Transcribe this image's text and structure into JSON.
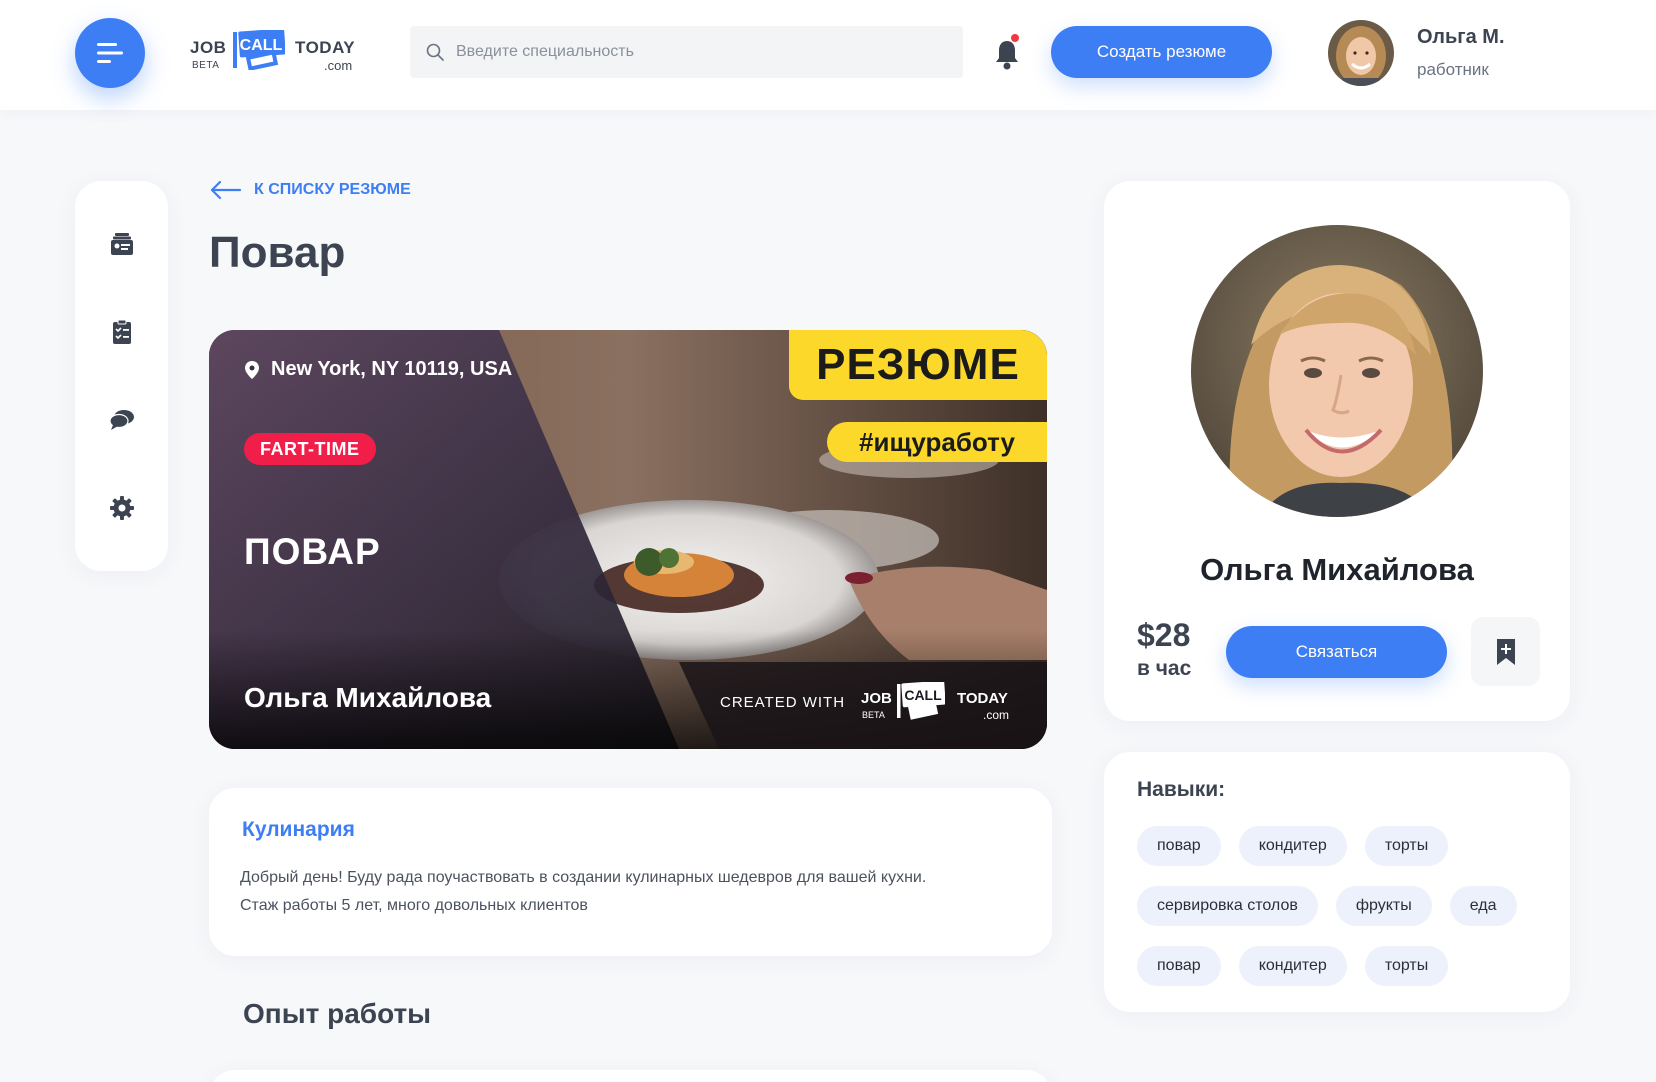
{
  "header": {
    "logo": {
      "job": "JOB",
      "beta": "BETA",
      "call": "CALL",
      "today": "TODAY",
      "com": ".com"
    },
    "search": {
      "placeholder": "Введите специальность",
      "value": ""
    },
    "create_resume_label": "Создать резюме",
    "user": {
      "name": "Ольга М.",
      "role": "работник"
    },
    "notification_dot_color": "#f2393e"
  },
  "sidebar": {
    "icons": [
      "resume-card-icon",
      "clipboard-checklist-icon",
      "chat-bubbles-icon",
      "gear-icon"
    ]
  },
  "main": {
    "back_label": "К СПИСКУ РЕЗЮМЕ",
    "title": "Повар",
    "banner": {
      "location": "New York, NY 10119, USA",
      "badge": "FART-TIME",
      "job": "ПОВАР",
      "name": "Ольга Михайлова",
      "resume_label": "РЕЗЮМЕ",
      "hashtag": "#ищуработу",
      "created_with": "CREATED WITH",
      "logo": {
        "job": "JOB",
        "beta": "BETA",
        "call": "CALL",
        "today": "TODAY",
        "com": ".com"
      }
    },
    "description": {
      "title": "Кулинария",
      "line1": "Добрый день! Буду рада поучаствовать в создании кулинарных шедевров для вашей кухни.",
      "line2": "Стаж работы 5 лет, много довольных клиентов"
    },
    "experience_title": "Опыт работы"
  },
  "profile": {
    "name": "Ольга Михайлова",
    "price": "$28",
    "per": "в час",
    "contact_label": "Связаться"
  },
  "skills": {
    "title": "Навыки:",
    "rows": [
      [
        "повар",
        "кондитер",
        "торты"
      ],
      [
        "сервировка столов",
        "фрукты",
        "еда"
      ],
      [
        "повар",
        "кондитер",
        "торты"
      ]
    ]
  },
  "colors": {
    "accent": "#3d7ef5",
    "badge": "#f11e4a",
    "highlight": "#fcd82b",
    "chip_bg": "#edf1fb"
  }
}
